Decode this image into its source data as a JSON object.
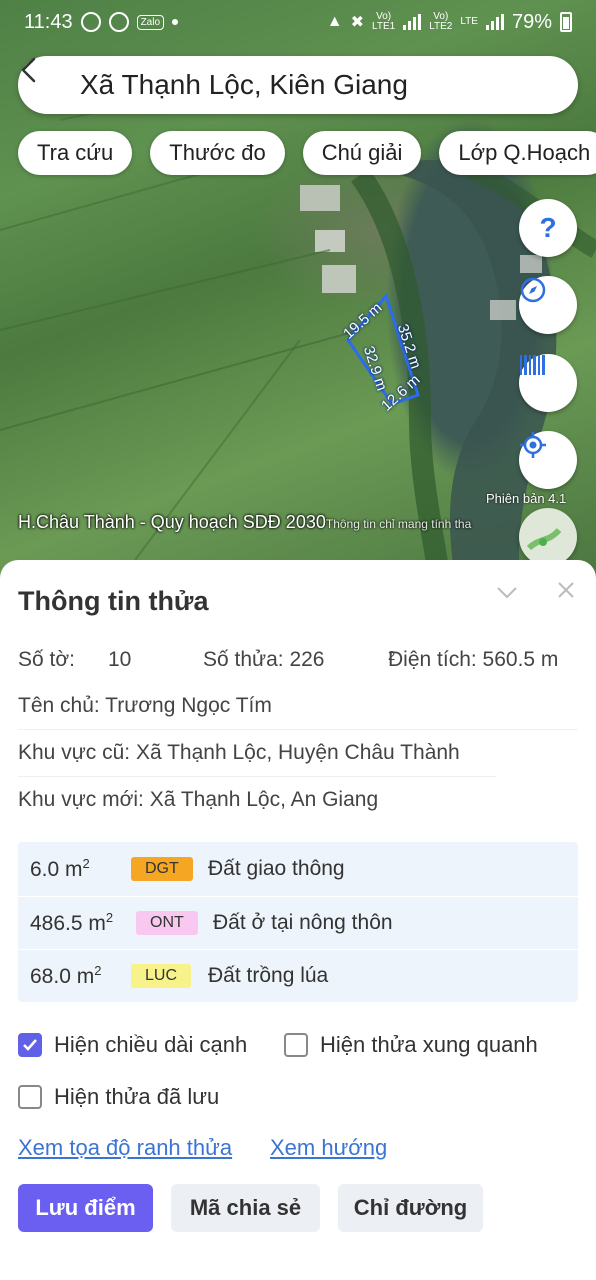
{
  "status_bar": {
    "time": "11:43",
    "zalo_label": "Zalo",
    "sim1_label": "Vo)\nLTE1",
    "sim2_label": "Vo)\nLTE2",
    "net_label": "LTE",
    "battery": "79%"
  },
  "search": {
    "title": "Xã Thạnh Lộc, Kiên Giang"
  },
  "chips": [
    "Tra cứu",
    "Thước đo",
    "Chú giải",
    "Lớp Q.Hoạch"
  ],
  "map": {
    "help_label": "?",
    "edge_labels": [
      "19.5 m",
      "35.2 m",
      "32.9 m",
      "12.6 m"
    ],
    "caption": "H.Châu Thành - Quy hoạch SDĐ 2030",
    "caption_note": "Thông tin chỉ mang tính tha",
    "version": "Phiên bản 4.1"
  },
  "parcel": {
    "title": "Thông tin thửa",
    "sheet_label": "Số tờ:",
    "sheet_value": "10",
    "parcel_label": "Số thửa: 226",
    "area_label": "Diện tích: 560.5 m",
    "area_sup": "2",
    "owner": "Tên chủ: Trương Ngọc Tím",
    "old_area": "Khu vực cũ: Xã Thạnh Lộc, Huyện Châu Thành",
    "new_area": "Khu vực mới: Xã Thạnh Lộc, An Giang"
  },
  "land_use": [
    {
      "area": "6.0 m",
      "sup": "2",
      "code": "DGT",
      "name": "Đất giao thông",
      "color": "#f5a623"
    },
    {
      "area": "486.5 m",
      "sup": "2",
      "code": "ONT",
      "name": "Đất ở tại nông thôn",
      "color": "#f9c8f0"
    },
    {
      "area": "68.0 m",
      "sup": "2",
      "code": "LUC",
      "name": "Đất trồng lúa",
      "color": "#f8f28a"
    }
  ],
  "options": {
    "show_edge_lengths": "Hiện chiều dài cạnh",
    "show_edge_lengths_checked": true,
    "show_nearby": "Hiện thửa xung quanh",
    "show_nearby_checked": false,
    "show_saved": "Hiện thửa đã lưu",
    "show_saved_checked": false
  },
  "links": {
    "coords": "Xem tọa độ ranh thửa",
    "direction": "Xem hướng"
  },
  "buttons": {
    "save": "Lưu điểm",
    "share": "Mã chia sẻ",
    "route": "Chỉ đường"
  },
  "colors": {
    "primary": "#6a5ff0",
    "link": "#3c74d6",
    "accent_blue": "#2f6fe0"
  }
}
